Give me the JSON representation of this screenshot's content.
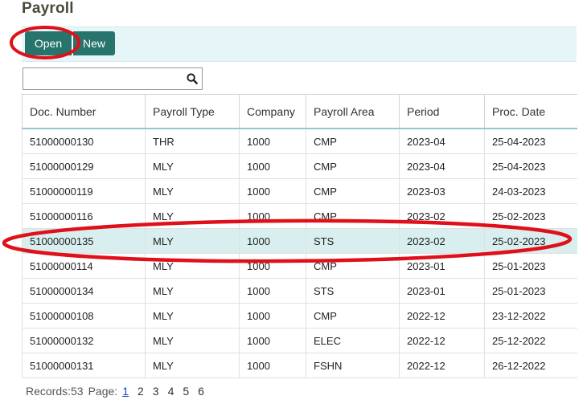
{
  "page": {
    "title": "Payroll"
  },
  "toolbar": {
    "open_label": "Open",
    "new_label": "New"
  },
  "search": {
    "value": "",
    "placeholder": ""
  },
  "table": {
    "columns": [
      "Doc. Number",
      "Payroll Type",
      "Company",
      "Payroll Area",
      "Period",
      "Proc. Date"
    ],
    "rows": [
      [
        "51000000130",
        "THR",
        "1000",
        "CMP",
        "2023-04",
        "25-04-2023"
      ],
      [
        "51000000129",
        "MLY",
        "1000",
        "CMP",
        "2023-04",
        "25-04-2023"
      ],
      [
        "51000000119",
        "MLY",
        "1000",
        "CMP",
        "2023-03",
        "24-03-2023"
      ],
      [
        "51000000116",
        "MLY",
        "1000",
        "CMP",
        "2023-02",
        "25-02-2023"
      ],
      [
        "51000000135",
        "MLY",
        "1000",
        "STS",
        "2023-02",
        "25-02-2023"
      ],
      [
        "51000000114",
        "MLY",
        "1000",
        "CMP",
        "2023-01",
        "25-01-2023"
      ],
      [
        "51000000134",
        "MLY",
        "1000",
        "STS",
        "2023-01",
        "25-01-2023"
      ],
      [
        "51000000108",
        "MLY",
        "1000",
        "CMP",
        "2022-12",
        "23-12-2022"
      ],
      [
        "51000000132",
        "MLY",
        "1000",
        "ELEC",
        "2022-12",
        "25-12-2022"
      ],
      [
        "51000000131",
        "MLY",
        "1000",
        "FSHN",
        "2022-12",
        "26-12-2022"
      ]
    ],
    "selected_row": 4
  },
  "footer": {
    "records_label": "Records:53",
    "page_label": "Page:",
    "pages": [
      "1",
      "2",
      "3",
      "4",
      "5",
      "6"
    ],
    "current_page": "1"
  },
  "colors": {
    "button_bg": "#27746c",
    "toolbar_bg": "#e6f5f8",
    "selected_row_bg": "#d9efef",
    "annotation": "#e0101a",
    "link": "#1a3fd6"
  }
}
